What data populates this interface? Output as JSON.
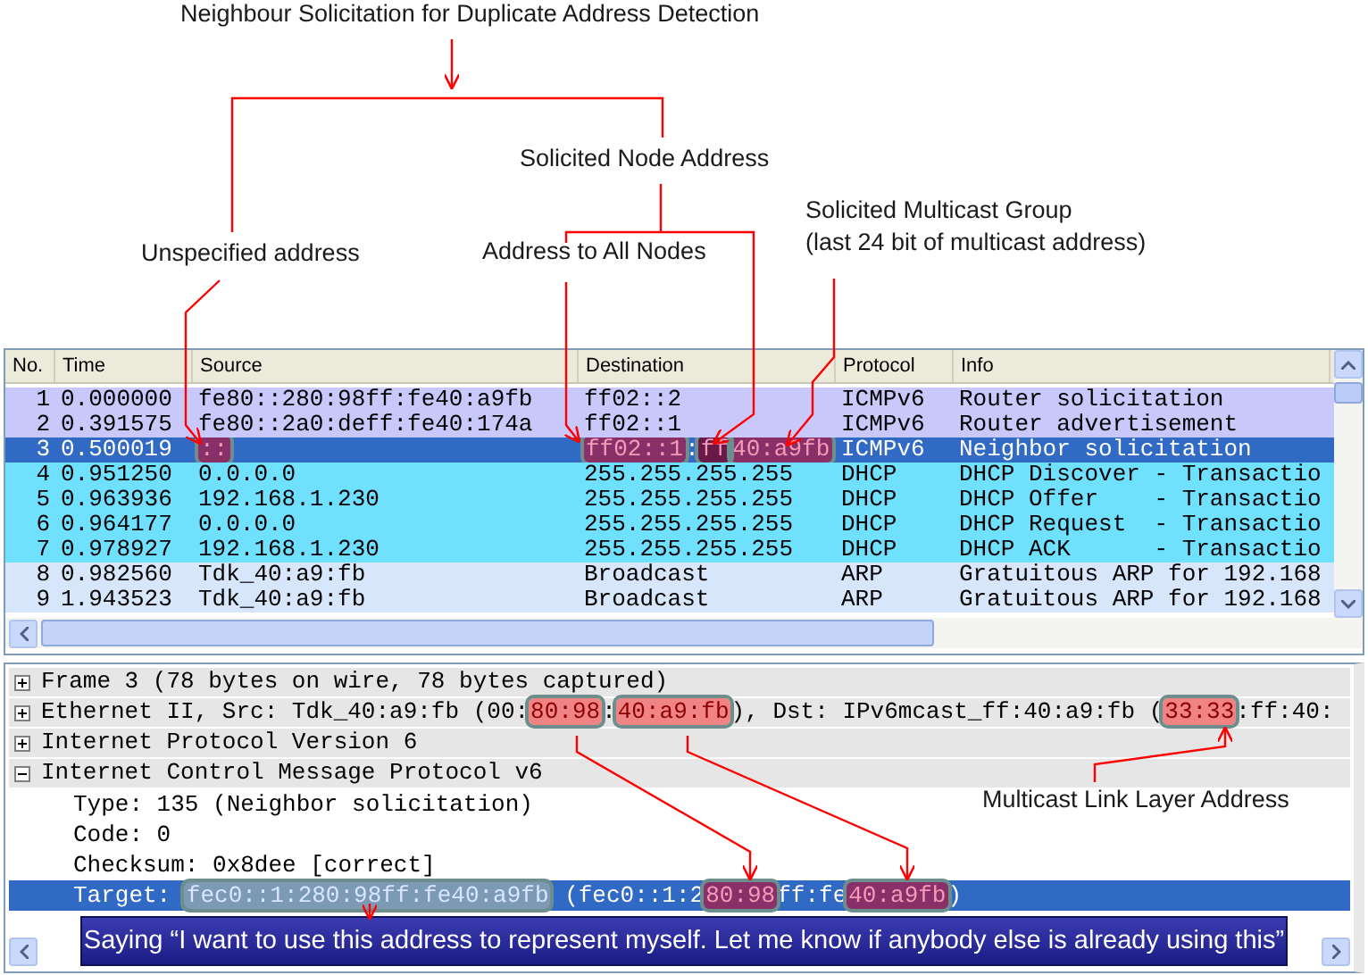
{
  "annotations": [
    {
      "text": "Neighbour Solicitation for Duplicate Address Detection"
    },
    {
      "text": "Solicited Node Address"
    },
    {
      "text": "Solicited Multicast Group"
    },
    {
      "text": "(last 24 bit of multicast address)"
    },
    {
      "text": "Unspecified address"
    },
    {
      "text": "Address to All Nodes"
    },
    {
      "text": "Multicast Link Layer Address"
    }
  ],
  "packets": {
    "columns": [
      "No.",
      "Time",
      "Source",
      "Destination",
      "Protocol",
      "Info"
    ],
    "rows": [
      {
        "no": "1",
        "time": "0.000000",
        "source": "fe80::280:98ff:fe40:a9fb",
        "destination": "ff02::2",
        "protocol": "ICMPv6",
        "info": "Router solicitation",
        "color": "#c8c8fa",
        "selected": false
      },
      {
        "no": "2",
        "time": "0.391575",
        "source": "fe80::2a0:deff:fe40:174a",
        "destination": "ff02::1",
        "protocol": "ICMPv6",
        "info": "Router advertisement",
        "color": "#c8c8fa",
        "selected": false
      },
      {
        "no": "3",
        "time": "0.500019",
        "source": [
          {
            "text": "::",
            "kind": "dark"
          }
        ],
        "destination": [
          {
            "text": "ff02::1",
            "kind": "dark"
          },
          {
            "text": ":",
            "kind": "plain"
          },
          {
            "text": "ff",
            "kind": "deep"
          },
          {
            "text": "40:a9fb",
            "kind": "dark"
          }
        ],
        "protocol": "ICMPv6",
        "info": "Neighbor solicitation",
        "selected": true
      },
      {
        "no": "4",
        "time": "0.951250",
        "source": "0.0.0.0",
        "destination": "255.255.255.255",
        "protocol": "DHCP",
        "info": "DHCP Discover - Transactio",
        "color": "#70e0ff",
        "selected": false
      },
      {
        "no": "5",
        "time": "0.963936",
        "source": "192.168.1.230",
        "destination": "255.255.255.255",
        "protocol": "DHCP",
        "info": "DHCP Offer    - Transactio",
        "color": "#70e0ff",
        "selected": false
      },
      {
        "no": "6",
        "time": "0.964177",
        "source": "0.0.0.0",
        "destination": "255.255.255.255",
        "protocol": "DHCP",
        "info": "DHCP Request  - Transactio",
        "color": "#70e0ff",
        "selected": false
      },
      {
        "no": "7",
        "time": "0.978927",
        "source": "192.168.1.230",
        "destination": "255.255.255.255",
        "protocol": "DHCP",
        "info": "DHCP ACK      - Transactio",
        "color": "#70e0ff",
        "selected": false
      },
      {
        "no": "8",
        "time": "0.982560",
        "source": "Tdk_40:a9:fb",
        "destination": "Broadcast",
        "protocol": "ARP",
        "info": "Gratuitous ARP for 192.168",
        "color": "#d7e6fb",
        "selected": false
      },
      {
        "no": "9",
        "time": "1.943523",
        "source": "Tdk_40:a9:fb",
        "destination": "Broadcast",
        "protocol": "ARP",
        "info": "Gratuitous ARP for 192.168",
        "color": "#d7e6fb",
        "selected": false
      }
    ]
  },
  "details": [
    {
      "text": "Frame 3 (78 bytes on wire, 78 bytes captured)",
      "expanded": false
    },
    {
      "text": [
        {
          "text": "Ethernet II, Src: Tdk_40:a9:fb (00:",
          "kind": "plain"
        },
        {
          "text": "80:98",
          "kind": "light"
        },
        {
          "text": ":",
          "kind": "plain"
        },
        {
          "text": "40:a9:fb",
          "kind": "light"
        },
        {
          "text": "), Dst: IPv6mcast_ff:40:a9:fb (",
          "kind": "plain"
        },
        {
          "text": "33:33",
          "kind": "light"
        },
        {
          "text": ":ff:40:",
          "kind": "plain"
        }
      ],
      "expanded": false
    },
    {
      "text": "Internet Protocol Version 6",
      "expanded": false
    },
    {
      "text": "Internet Control Message Protocol v6",
      "expanded": true,
      "children": [
        {
          "text": "Type: 135 (Neighbor solicitation)",
          "selected": false
        },
        {
          "text": "Code: 0",
          "selected": false
        },
        {
          "text": "Checksum: 0x8dee [correct]",
          "selected": false
        },
        {
          "text": [
            {
              "text": "Target: ",
              "kind": "plain"
            },
            {
              "text": "fec0::1:280:98ff:fe40:a9fb",
              "kind": "frame"
            },
            {
              "text": " (fec0::1:2",
              "kind": "plain"
            },
            {
              "text": "80:98",
              "kind": "dark"
            },
            {
              "text": "ff:fe",
              "kind": "plain"
            },
            {
              "text": "40:a9fb",
              "kind": "dark"
            },
            {
              "text": ")",
              "kind": "plain"
            }
          ],
          "selected": true
        }
      ]
    }
  ],
  "banner": {
    "text": "Saying “I want to use this address to represent myself. Let me know  if anybody else is already using this”"
  }
}
